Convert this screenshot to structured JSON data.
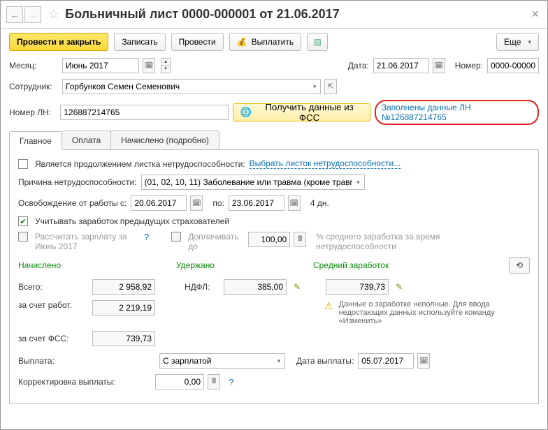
{
  "title": "Больничный лист 0000-000001 от 21.06.2017",
  "toolbar": {
    "post_close": "Провести и закрыть",
    "save": "Записать",
    "post": "Провести",
    "pay": "Выплатить",
    "more": "Еще"
  },
  "header": {
    "month_label": "Месяц:",
    "month_value": "Июнь 2017",
    "date_label": "Дата:",
    "date_value": "21.06.2017",
    "number_label": "Номер:",
    "number_value": "0000-00000",
    "employee_label": "Сотрудник:",
    "employee_value": "Горбунков Семен Семенович",
    "ln_label": "Номер ЛН:",
    "ln_value": "126887214765",
    "fss_btn": "Получить данные из ФСС",
    "ln_link": "Заполнены данные ЛН №126887214765"
  },
  "tabs": {
    "main": "Главное",
    "payment": "Оплата",
    "accrued": "Начислено (подробно)"
  },
  "main": {
    "continuation_label": "Является продолжением листка нетрудоспособности:",
    "continuation_link": "Выбрать листок нетрудоспособности...",
    "reason_label": "Причина нетрудоспособности:",
    "reason_value": "(01, 02, 10, 11) Заболевание или травма (кроме травм",
    "release_label": "Освобождение от работы с:",
    "release_from": "20.06.2017",
    "release_to_label": "по:",
    "release_to": "23.06.2017",
    "release_days": "4 дн.",
    "prev_insurers": "Учитывать заработок предыдущих страхователей",
    "recalc_salary": "Рассчитать зарплату за Июнь 2017",
    "pay_additional": "Доплачивать до",
    "percent_value": "100,00",
    "percent_hint": "% среднего заработка за время нетрудоспособности",
    "accrued_heading": "Начислено",
    "withheld_heading": "Удержано",
    "avg_heading": "Средний заработок",
    "total_label": "Всего:",
    "total_value": "2 958,92",
    "employer_label": "за счет работ.",
    "employer_value": "2 219,19",
    "fss_amount_label": "за счет ФСС:",
    "fss_amount_value": "739,73",
    "ndfl_label": "НДФЛ:",
    "ndfl_value": "385,00",
    "avg_value": "739,73",
    "warning_text": "Данные о заработке неполные. Для ввода недостающих данных используйте команду «Изменить»",
    "payout_label": "Выплата:",
    "payout_value": "С зарплатой",
    "payout_date_label": "Дата выплаты:",
    "payout_date_value": "05.07.2017",
    "correction_label": "Корректировка выплаты:",
    "correction_value": "0,00"
  }
}
